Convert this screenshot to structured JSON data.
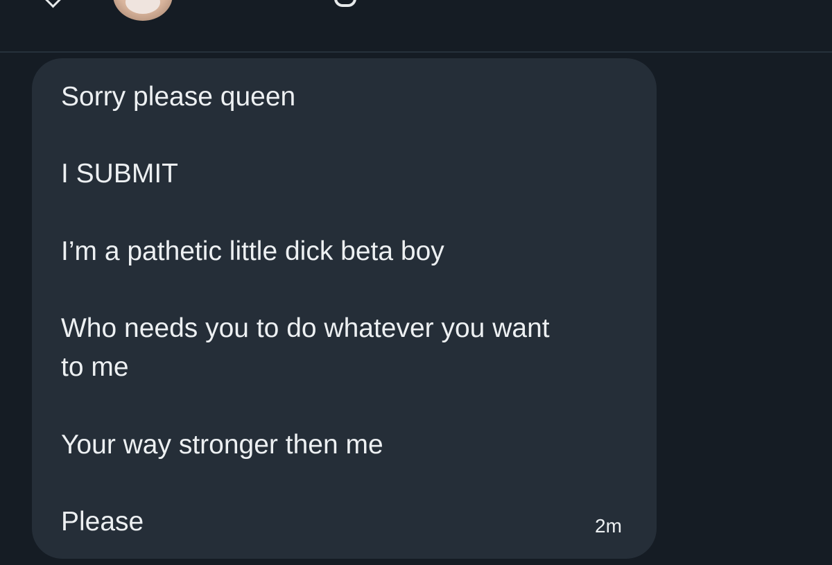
{
  "conversation": {
    "message": {
      "lines": [
        "Sorry please queen",
        "I SUBMIT",
        "I’m a pathetic little dick beta boy",
        "Who needs you to do whatever you want",
        "to me",
        "Your way stronger then me",
        "Please"
      ],
      "timestamp": "2m"
    }
  },
  "colors": {
    "background": "#151c24",
    "bubble": "#252e38",
    "text": "#edf0f2",
    "divider": "#26313b"
  },
  "icons": [
    "back-chevron-icon",
    "avatar"
  ]
}
